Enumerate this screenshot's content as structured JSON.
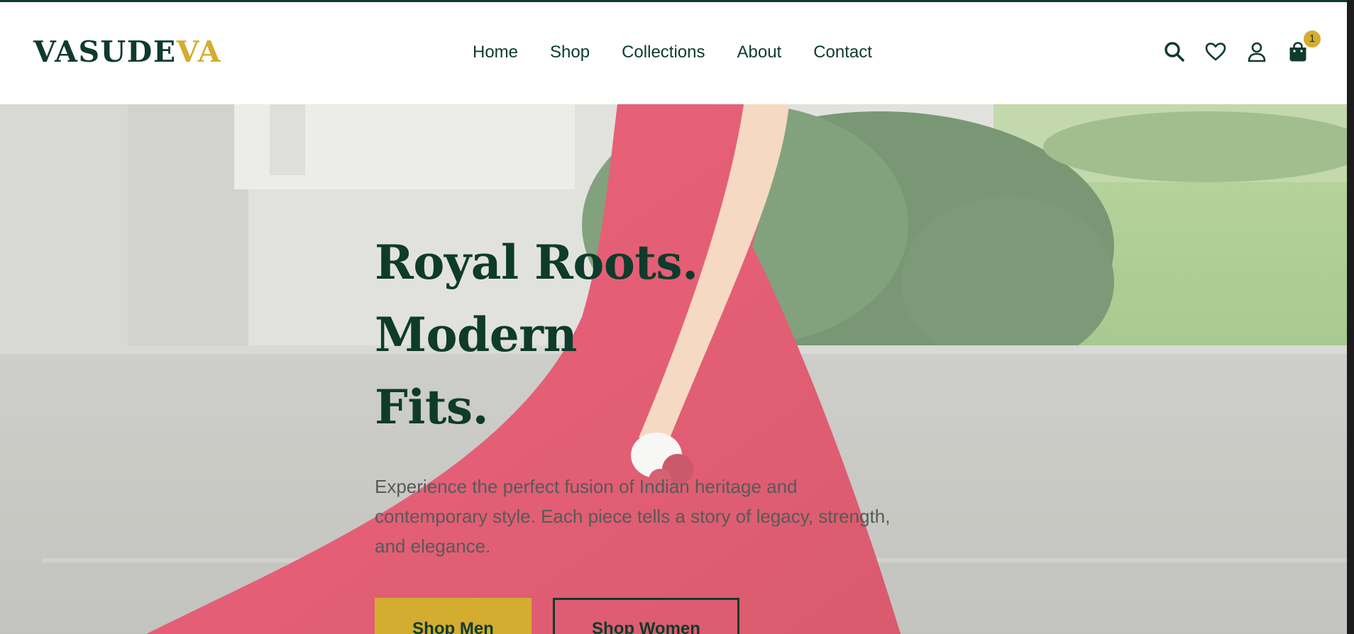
{
  "brand": {
    "logo_main": "VASUDE",
    "logo_accent": "VA",
    "primary_color": "#0e3b2b",
    "accent_color": "#d4ac30"
  },
  "nav": {
    "items": [
      {
        "label": "Home"
      },
      {
        "label": "Shop"
      },
      {
        "label": "Collections"
      },
      {
        "label": "About"
      },
      {
        "label": "Contact"
      }
    ]
  },
  "header_icons": {
    "search": "search-icon",
    "wishlist": "heart-icon",
    "account": "user-icon",
    "cart": "shopping-bag-icon",
    "cart_count": "1"
  },
  "hero": {
    "title_line1": "Royal Roots. Modern",
    "title_line2": "Fits.",
    "subtitle": "Experience the perfect fusion of Indian heritage and contemporary style. Each piece tells a story of legacy, strength, and elegance.",
    "btn_men": "Shop Men",
    "btn_women": "Shop Women"
  }
}
